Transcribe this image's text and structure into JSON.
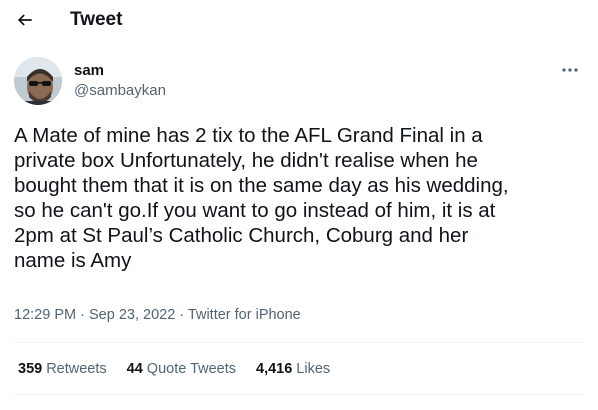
{
  "header": {
    "title": "Tweet",
    "back_icon": "arrow-left-icon"
  },
  "tweet": {
    "author_name": "sam",
    "author_handle": "@sambaykan",
    "more_icon": "more-options-icon",
    "text_lines": [
      "A Mate of mine has 2 tix to the AFL Grand Final in a",
      "private box Unfortunately, he didn't realise when he",
      "bought them that it is on the same day as his wedding,",
      "so he can't go.If you want to go instead of him, it is at",
      "2pm at St Paul’s Catholic Church, Coburg and her",
      "name is Amy"
    ],
    "time": "12:29 PM",
    "date": "Sep 23, 2022",
    "source": "Twitter for iPhone",
    "separator": "·"
  },
  "stats": {
    "retweets_count": "359",
    "retweets_label": "Retweets",
    "quote_count": "44",
    "quote_label": "Quote Tweets",
    "likes_count": "4,416",
    "likes_label": "Likes"
  },
  "colors": {
    "text_primary": "#0f1419",
    "text_secondary": "#536471",
    "divider": "#eff3f4"
  }
}
